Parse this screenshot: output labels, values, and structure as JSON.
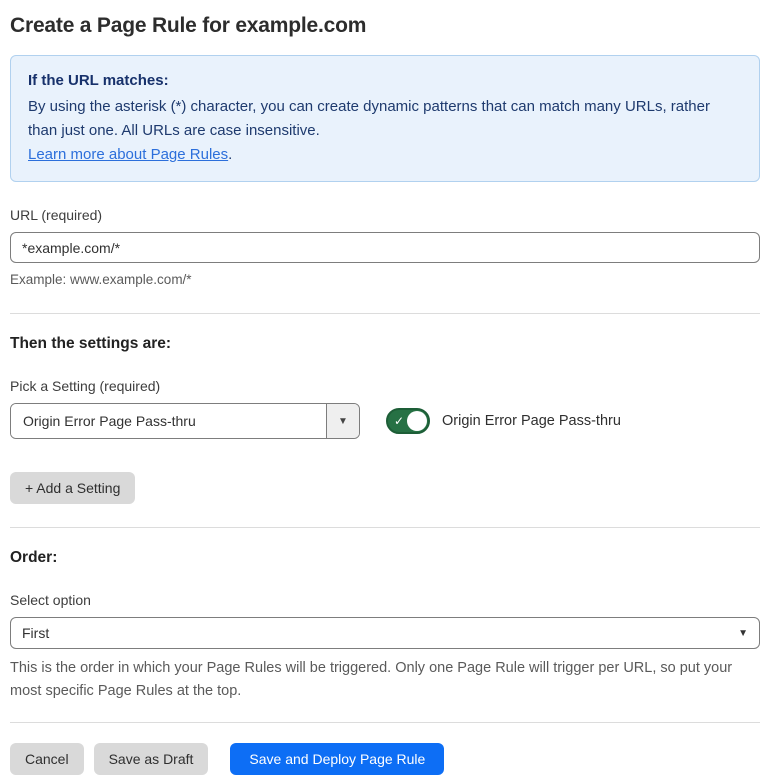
{
  "page": {
    "title": "Create a Page Rule for example.com"
  },
  "info_box": {
    "heading": "If the URL matches:",
    "body": "By using the asterisk (*) character, you can create dynamic patterns that can match many URLs, rather than just one. All URLs are case insensitive.",
    "link_label": "Learn more about Page Rules",
    "link_suffix": "."
  },
  "url_field": {
    "label": "URL (required)",
    "value": "*example.com/*",
    "helper": "Example: www.example.com/*"
  },
  "settings_section": {
    "heading": "Then the settings are:",
    "picker_label": "Pick a Setting (required)",
    "picker_value": "Origin Error Page Pass-thru",
    "picker_caret": "▼",
    "toggle_state": "on",
    "toggle_check": "✓",
    "toggle_label": "Origin Error Page Pass-thru",
    "add_setting_label": "+ Add a Setting"
  },
  "order_section": {
    "heading": "Order:",
    "select_label": "Select option",
    "select_value": "First",
    "select_caret": "▼",
    "helper": "This is the order in which your Page Rules will be triggered. Only one Page Rule will trigger per URL, so put your most specific Page Rules at the top."
  },
  "footer": {
    "cancel_label": "Cancel",
    "save_draft_label": "Save as Draft",
    "save_deploy_label": "Save and Deploy Page Rule"
  },
  "colors": {
    "accent_blue": "#0d6ef5",
    "info_background": "#e9f2fc",
    "info_border": "#b1d1ef",
    "info_text": "#1e3a6e",
    "link_blue": "#2c6fdb",
    "toggle_green_on": "#267144",
    "gray_button": "#d9d9d9"
  }
}
